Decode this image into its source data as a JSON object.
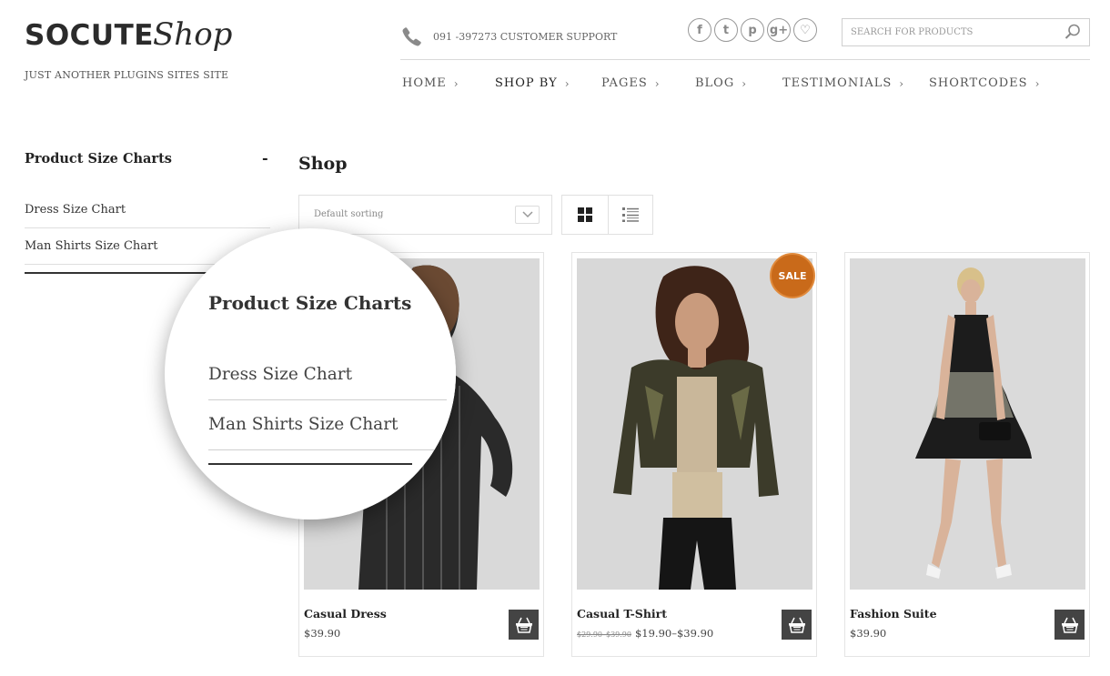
{
  "header": {
    "logo_main": "SOCUTE",
    "logo_script": "Shop",
    "tagline": "JUST ANOTHER PLUGINS SITES SITE",
    "support_text": "091 -397273 CUSTOMER SUPPORT",
    "social": [
      {
        "icon": "facebook-icon",
        "glyph": "f"
      },
      {
        "icon": "twitter-icon",
        "glyph": "t"
      },
      {
        "icon": "pinterest-icon",
        "glyph": "p"
      },
      {
        "icon": "google-plus-icon",
        "glyph": "g+"
      },
      {
        "icon": "heart-icon",
        "glyph": "♡"
      }
    ],
    "search_placeholder": "SEARCH FOR PRODUCTS",
    "nav": [
      {
        "label": "HOME"
      },
      {
        "label": "SHOP BY"
      },
      {
        "label": "PAGES"
      },
      {
        "label": "BLOG"
      },
      {
        "label": "TESTIMONIALS"
      },
      {
        "label": "SHORTCODES"
      }
    ]
  },
  "sidebar": {
    "title": "Product Size Charts",
    "toggle": "-",
    "links": [
      "Dress Size Chart",
      "Man Shirts Size Chart"
    ]
  },
  "magnifier": {
    "title": "Product Size Charts",
    "links": [
      "Dress Size Chart",
      "Man Shirts Size Chart"
    ]
  },
  "main": {
    "title": "Shop",
    "sort_value": "Default sorting",
    "sale_badge": "SALE",
    "products": [
      {
        "name": "Casual Dress",
        "price": "$39.90",
        "old_price": ""
      },
      {
        "name": "Casual T-Shirt",
        "price": "$19.90–$39.90",
        "old_price": "$29.90–$39.90"
      },
      {
        "name": "Fashion Suite",
        "price": "$39.90",
        "old_price": ""
      }
    ]
  },
  "colors": {
    "sale": "#c96a1a",
    "cart_button": "#444444",
    "text_dark": "#222222"
  }
}
